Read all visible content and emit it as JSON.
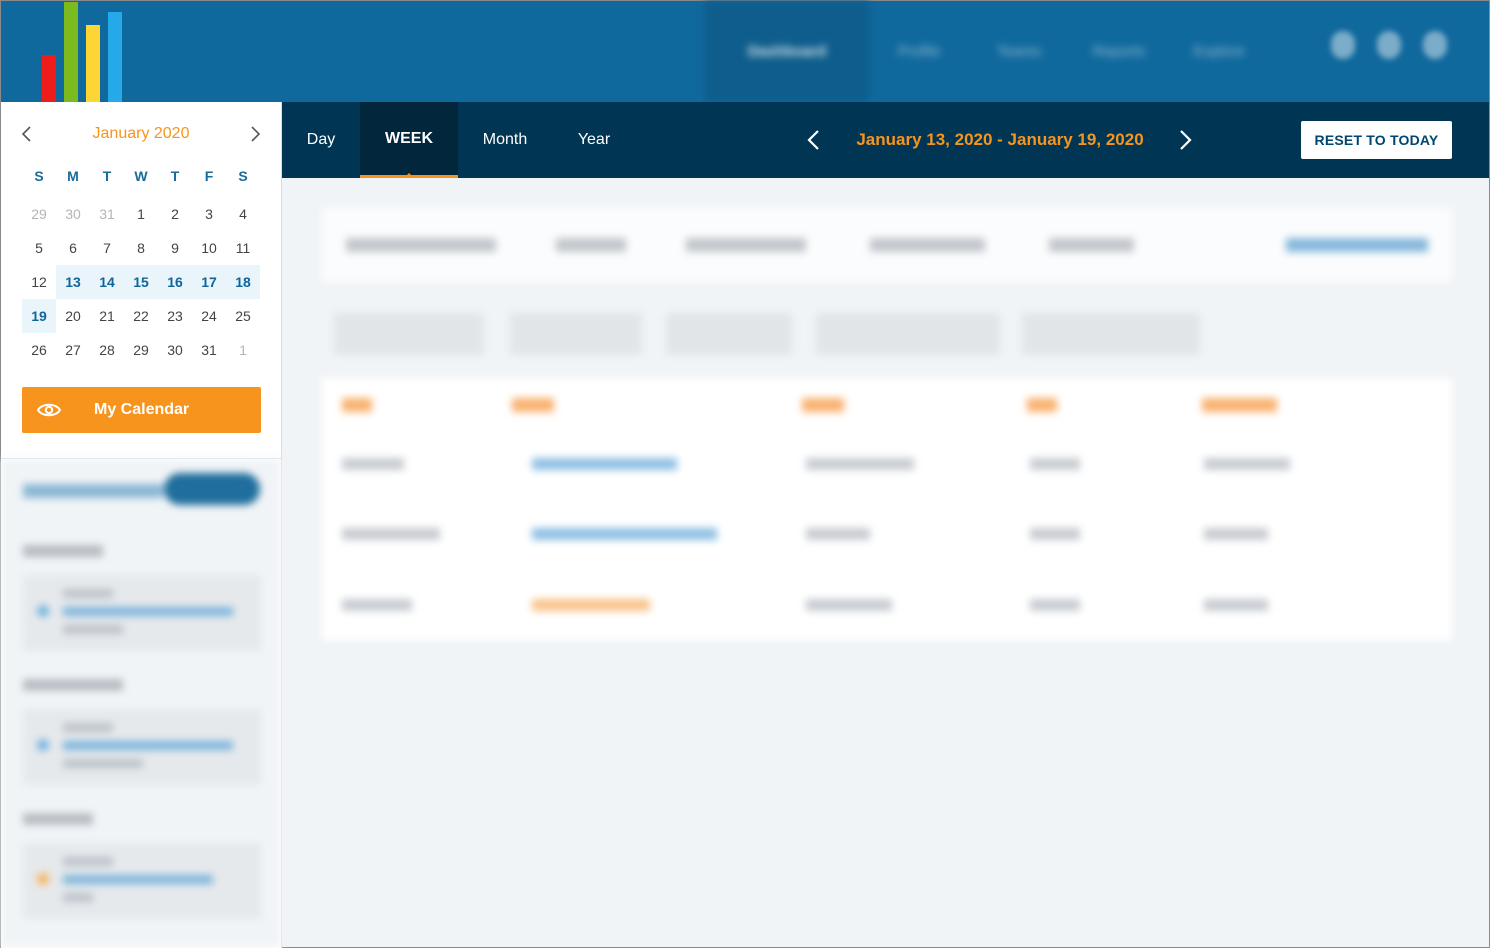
{
  "header": {
    "nav": [
      "Dashboard",
      "Profile",
      "Teams",
      "Reports",
      "Explore"
    ]
  },
  "mini_calendar": {
    "month_label": "January 2020",
    "weekday_labels": [
      "S",
      "M",
      "T",
      "W",
      "T",
      "F",
      "S"
    ],
    "weeks": [
      [
        "29",
        "30",
        "31",
        "1",
        "2",
        "3",
        "4"
      ],
      [
        "5",
        "6",
        "7",
        "8",
        "9",
        "10",
        "11"
      ],
      [
        "12",
        "13",
        "14",
        "15",
        "16",
        "17",
        "18"
      ],
      [
        "19",
        "20",
        "21",
        "22",
        "23",
        "24",
        "25"
      ],
      [
        "26",
        "27",
        "28",
        "29",
        "30",
        "31",
        "1"
      ]
    ],
    "selected_range": "13–19"
  },
  "my_calendar_button": {
    "label": "My Calendar"
  },
  "view_tabs": {
    "day": "Day",
    "week": "WEEK",
    "month": "Month",
    "year": "Year",
    "active": "week"
  },
  "date_range": {
    "label": "January 13, 2020 - January 19, 2020"
  },
  "reset_button": {
    "label": "RESET TO TODAY"
  },
  "colors": {
    "header_bg": "#10699d",
    "viewbar_bg": "#003654",
    "accent": "#f7941d",
    "link_blue": "#0f6599"
  }
}
